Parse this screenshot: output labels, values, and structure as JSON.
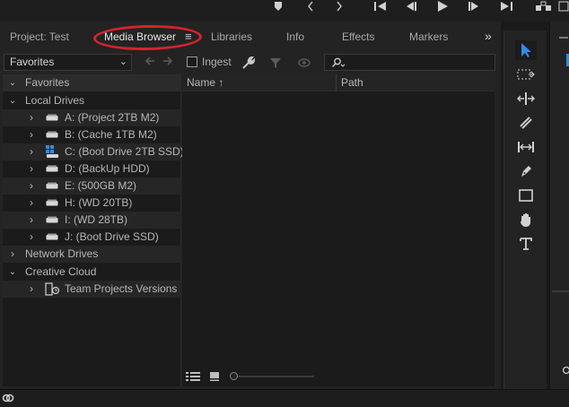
{
  "tabs": {
    "project": "Project: Test",
    "media_browser": "Media Browser",
    "media_browser_menu": "≡",
    "libraries": "Libraries",
    "info": "Info",
    "effects": "Effects",
    "markers": "Markers",
    "overflow": "»"
  },
  "toolbar": {
    "location_select": "Favorites",
    "ingest_label": "Ingest",
    "search_placeholder": ""
  },
  "tree": {
    "favorites": "Favorites",
    "local_drives": "Local Drives",
    "drives": [
      "A: (Project 2TB M2)",
      "B: (Cache 1TB M2)",
      "C: (Boot Drive 2TB SSD)",
      "D: (BackUp HDD)",
      "E: (500GB M2)",
      "H: (WD 20TB)",
      "I: (WD 28TB)",
      "J: (Boot Drive SSD)"
    ],
    "network_drives": "Network Drives",
    "creative_cloud": "Creative Cloud",
    "team_projects": "Team Projects Versions"
  },
  "list": {
    "col_name": "Name",
    "col_name_sort": "↑",
    "col_path": "Path"
  },
  "colors": {
    "accent_blue": "#2d8ceb",
    "highlight_ring": "#d6232d"
  }
}
